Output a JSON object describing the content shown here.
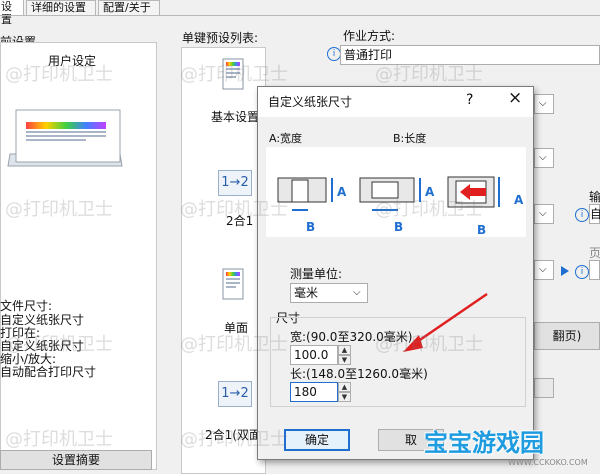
{
  "tabs": [
    "设置",
    "详细的设置",
    "配置/关于"
  ],
  "left": {
    "current_settings": "前设置",
    "user_settings": "用户设定",
    "summary_lines": [
      "文件尺寸:",
      "自定义纸张尺寸",
      "打印在:",
      "自定义纸张尺寸",
      "缩小/放大:",
      "自动配合打印尺寸"
    ],
    "summary_button": "设置摘要"
  },
  "presets": {
    "title": "单键预设列表:",
    "items": [
      "基本设置",
      "2合1",
      "单面",
      "2合1(双面"
    ],
    "icon_text": "1→2"
  },
  "right": {
    "job_mode_label": "作业方式:",
    "job_mode_value": "普通打印",
    "partial_1": "输",
    "partial_2": "自",
    "partial_3": "页",
    "partial_4": "翻页)"
  },
  "dialog": {
    "title": "自定义纸张尺寸",
    "help": "?",
    "close": "×",
    "label_width": "A:宽度",
    "label_length": "B:长度",
    "marker_a": "A",
    "marker_b": "B",
    "unit_label": "测量单位:",
    "unit_value": "毫米",
    "size_group": "尺寸",
    "width_label": "宽:(90.0至320.0毫米)",
    "width_value": "100.0",
    "length_label": "长:(148.0至1260.0毫米)",
    "length_value": "180",
    "ok": "确定",
    "cancel_partial": "取"
  },
  "watermark": "@打印机卫士",
  "logo": {
    "text": "宝宝游戏园",
    "sub": "WWW.CCKOKO.COM"
  },
  "colors": {
    "accent": "#1f6fd1",
    "arrow": "#e02020",
    "logo": "#1f9be0"
  }
}
